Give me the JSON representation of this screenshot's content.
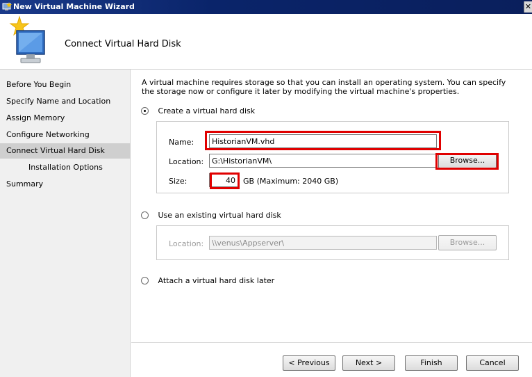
{
  "window": {
    "title": "New Virtual Machine Wizard",
    "close_glyph": "✕",
    "icon": "wizard-app-icon"
  },
  "header": {
    "heading": "Connect Virtual Hard Disk",
    "icon": "virtual-machine-wizard-icon"
  },
  "sidebar": {
    "items": [
      {
        "label": "Before You Begin"
      },
      {
        "label": "Specify Name and Location"
      },
      {
        "label": "Assign Memory"
      },
      {
        "label": "Configure Networking"
      },
      {
        "label": "Connect Virtual Hard Disk",
        "active": true
      },
      {
        "label": "Installation Options",
        "sub": true
      },
      {
        "label": "Summary"
      }
    ]
  },
  "main": {
    "intro": "A virtual machine requires storage so that you can install an operating system. You can specify the storage now or configure it later by modifying the virtual machine's properties.",
    "create_option": {
      "label": "Create a virtual hard disk",
      "selected": true,
      "name_label": "Name:",
      "name_value": "HistorianVM.vhd",
      "location_label": "Location:",
      "location_value": "G:\\HistorianVM\\",
      "browse_label": "Browse...",
      "size_label": "Size:",
      "size_value": "40",
      "size_suffix": "GB (Maximum: 2040 GB)"
    },
    "existing_option": {
      "label": "Use an existing virtual hard disk",
      "selected": false,
      "location_label": "Location:",
      "location_value": "\\\\venus\\Appserver\\",
      "browse_label": "Browse..."
    },
    "attach_later_option": {
      "label": "Attach a virtual hard disk later",
      "selected": false
    }
  },
  "footer": {
    "previous_label": "< Previous",
    "next_label": "Next >",
    "finish_label": "Finish",
    "cancel_label": "Cancel"
  },
  "colors": {
    "titlebar": "#0a246a",
    "highlight": "#e00000",
    "sidebar_bg": "#f0f0f0",
    "sidebar_active": "#cfcfcf"
  }
}
